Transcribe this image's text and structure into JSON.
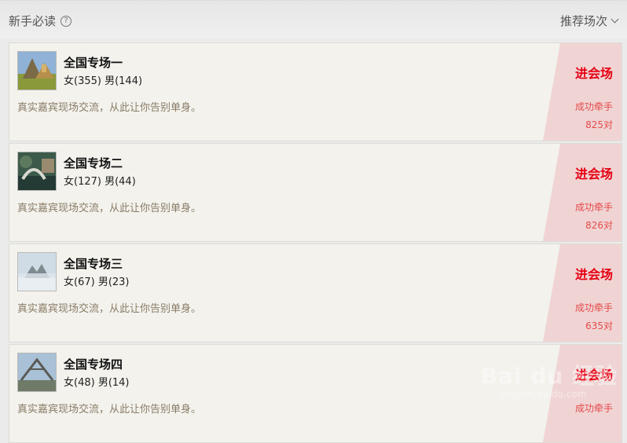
{
  "header": {
    "guide_label": "新手必读",
    "help_icon": "?",
    "sort_label": "推荐场次"
  },
  "venues": [
    {
      "title": "全国专场一",
      "counts": "女(355) 男(144)",
      "description": "真实嘉宾现场交流，从此让你告别单身。",
      "enter_label": "进会场",
      "success_label": "成功牵手",
      "pairs": "825对",
      "thumb_icon": "landscape-thumbnail"
    },
    {
      "title": "全国专场二",
      "counts": "女(127) 男(44)",
      "description": "真实嘉宾现场交流，从此让你告别单身。",
      "enter_label": "进会场",
      "success_label": "成功牵手",
      "pairs": "826对",
      "thumb_icon": "landscape-thumbnail"
    },
    {
      "title": "全国专场三",
      "counts": "女(67) 男(23)",
      "description": "真实嘉宾现场交流，从此让你告别单身。",
      "enter_label": "进会场",
      "success_label": "成功牵手",
      "pairs": "635对",
      "thumb_icon": "landscape-thumbnail"
    },
    {
      "title": "全国专场四",
      "counts": "女(48) 男(14)",
      "description": "真实嘉宾现场交流，从此让你告别单身。",
      "enter_label": "进会场",
      "success_label": "成功牵手",
      "pairs": "",
      "thumb_icon": "landscape-thumbnail"
    }
  ],
  "watermark": {
    "brand": "Bai du 经验",
    "url": "jingyan.baidu.com"
  },
  "colors": {
    "accent": "#e60012",
    "enter_bg": "#f0d4d4",
    "card_bg": "#f3f2ed"
  }
}
